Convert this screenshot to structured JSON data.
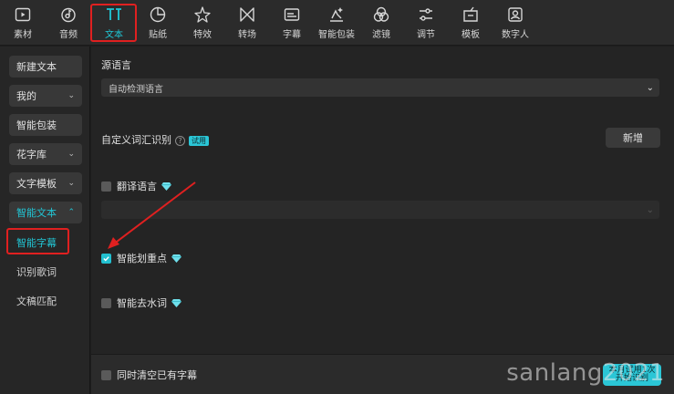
{
  "toolbar": {
    "items": [
      {
        "label": "素材",
        "icon": "media-icon"
      },
      {
        "label": "音频",
        "icon": "audio-icon"
      },
      {
        "label": "文本",
        "icon": "text-icon",
        "active": true
      },
      {
        "label": "贴纸",
        "icon": "sticker-icon"
      },
      {
        "label": "特效",
        "icon": "effects-icon"
      },
      {
        "label": "转场",
        "icon": "transition-icon"
      },
      {
        "label": "字幕",
        "icon": "subtitle-icon"
      },
      {
        "label": "智能包装",
        "icon": "smart-pack-icon"
      },
      {
        "label": "滤镜",
        "icon": "filter-icon"
      },
      {
        "label": "调节",
        "icon": "adjust-icon"
      },
      {
        "label": "模板",
        "icon": "template-icon"
      },
      {
        "label": "数字人",
        "icon": "digital-human-icon"
      }
    ],
    "accent_color": "#1fc8d7"
  },
  "sidebar": {
    "new_text": "新建文本",
    "mine": "我的",
    "smart_pack": "智能包装",
    "fancy_fonts": "花字库",
    "text_templates": "文字模板",
    "smart_text": "智能文本",
    "sub_items": [
      "智能字幕",
      "识别歌词",
      "文稿匹配"
    ]
  },
  "main": {
    "source_lang_label": "源语言",
    "source_lang_value": "自动检测语言",
    "custom_vocab_label": "自定义词汇识别",
    "trial_badge": "试用",
    "add_button": "新增",
    "translate_label": "翻译语言",
    "highlight_label": "智能划重点",
    "highlight_checked": true,
    "remove_filler_label": "智能去水词",
    "clear_existing_label": "同时清空已有字幕",
    "start_button_line1": "本月试用1次",
    "start_button_line2": "开始识别"
  },
  "watermark": "sanlang2021"
}
